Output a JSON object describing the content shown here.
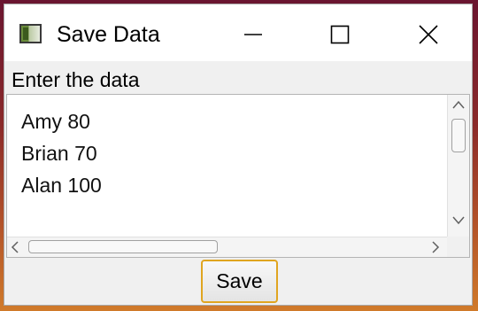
{
  "window": {
    "title": "Save Data",
    "controls": {
      "minimize": "minimize-icon",
      "maximize": "maximize-icon",
      "close": "close-icon"
    }
  },
  "form": {
    "label": "Enter the data",
    "text_lines": [
      "Amy 80",
      "Brian 70",
      "Alan 100"
    ],
    "save_label": "Save"
  },
  "colors": {
    "focus_border": "#e0a520",
    "window_bg": "#f0f0f0",
    "titlebar_bg": "#ffffff"
  }
}
